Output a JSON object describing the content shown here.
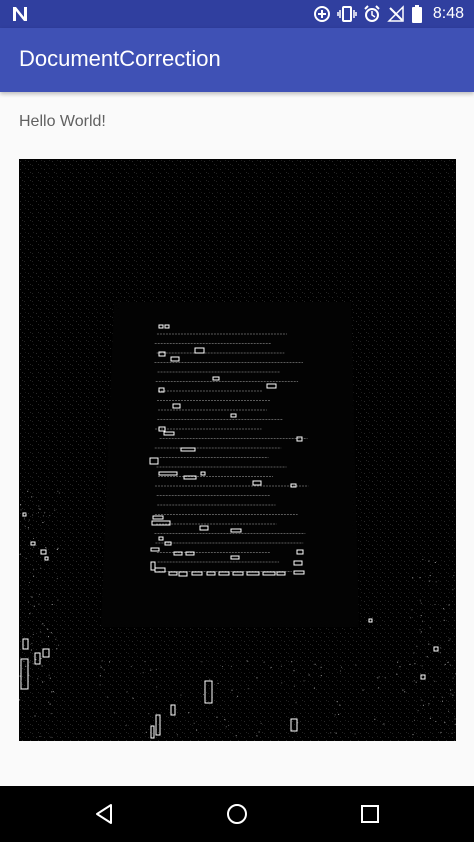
{
  "status_bar": {
    "time": "8:48",
    "icons": [
      "n-notification-icon",
      "add-circle-icon",
      "vibrate-icon",
      "alarm-icon",
      "signal-icon",
      "battery-icon"
    ]
  },
  "app_bar": {
    "title": "DocumentCorrection"
  },
  "main": {
    "hello_text": "Hello World!"
  },
  "nav_bar": {
    "buttons": [
      "back-icon",
      "home-icon",
      "recents-icon"
    ]
  },
  "colors": {
    "primary": "#3f51b5",
    "primary_dark": "#303f9f",
    "background": "#fafafa",
    "image_background": "#000000"
  }
}
